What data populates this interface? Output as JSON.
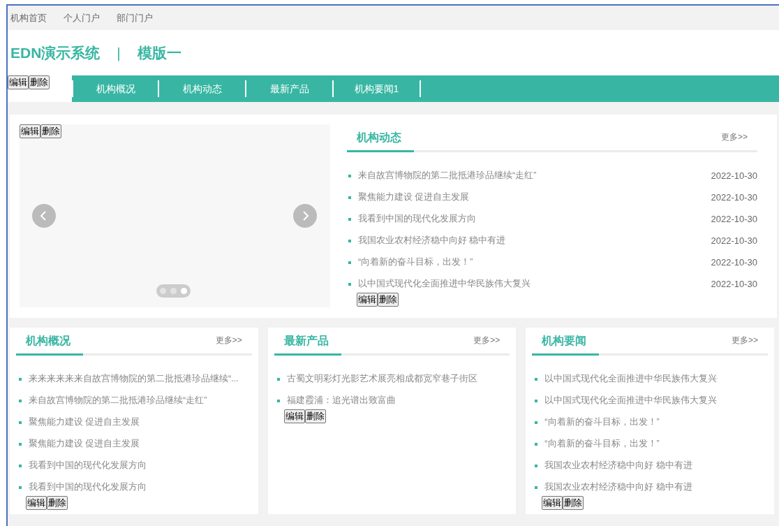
{
  "top_links": [
    "机构首页",
    "个人门户",
    "部门门户"
  ],
  "site_title": {
    "name": "EDN演示系统",
    "separator": "|",
    "template": "模版一"
  },
  "tabs": [
    {
      "kind": "buttons",
      "selected": true,
      "buttons": [
        "编辑",
        "删除"
      ]
    },
    {
      "kind": "label",
      "selected": false,
      "label": "机构概况"
    },
    {
      "kind": "label",
      "selected": false,
      "label": "机构动态"
    },
    {
      "kind": "label",
      "selected": false,
      "label": "最新产品"
    },
    {
      "kind": "label",
      "selected": false,
      "label": "机构要闻1"
    }
  ],
  "carousel": {
    "buttons": [
      "编辑",
      "删除"
    ],
    "dots": [
      {
        "selected": false
      },
      {
        "selected": false
      },
      {
        "selected": true
      }
    ]
  },
  "news_panel": {
    "title": "机构动态",
    "more": "更多>>",
    "items": [
      {
        "title": "来自故宫博物院的第二批抵港珍品继续“走红”",
        "date": "2022-10-30"
      },
      {
        "title": "聚焦能力建设 促进自主发展",
        "date": "2022-10-30"
      },
      {
        "title": "我看到中国的现代化发展方向",
        "date": "2022-10-30"
      },
      {
        "title": "我国农业农村经济稳中向好 稳中有进",
        "date": "2022-10-30"
      },
      {
        "title": "“向着新的奋斗目标，出发！”",
        "date": "2022-10-30"
      },
      {
        "title": "以中国式现代化全面推进中华民族伟大复兴",
        "date": "2022-10-30"
      }
    ],
    "buttons": [
      "编辑",
      "删除"
    ]
  },
  "cards": [
    {
      "title": "机构概况",
      "more": "更多>>",
      "items": [
        "来来来来来来自故宫博物院的第二批抵港珍品继续“...",
        "来自故宫博物院的第二批抵港珍品继续“走红”",
        "聚焦能力建设 促进自主发展",
        "聚焦能力建设 促进自主发展",
        "我看到中国的现代化发展方向",
        "我看到中国的现代化发展方向"
      ],
      "buttons": [
        "编辑",
        "删除"
      ]
    },
    {
      "title": "最新产品",
      "more": "更多>>",
      "items": [
        "古蜀文明彩灯光影艺术展亮相成都宽窄巷子街区",
        "福建霞浦：追光谱出致富曲"
      ],
      "buttons": [
        "编辑",
        "删除"
      ]
    },
    {
      "title": "机构要闻",
      "more": "更多>>",
      "items": [
        "以中国式现代化全面推进中华民族伟大复兴",
        "以中国式现代化全面推进中华民族伟大复兴",
        "“向着新的奋斗目标，出发！”",
        "“向着新的奋斗目标，出发！”",
        "我国农业农村经济稳中向好 稳中有进",
        "我国农业农村经济稳中向好 稳中有进"
      ],
      "buttons": [
        "编辑",
        "删除"
      ]
    }
  ]
}
